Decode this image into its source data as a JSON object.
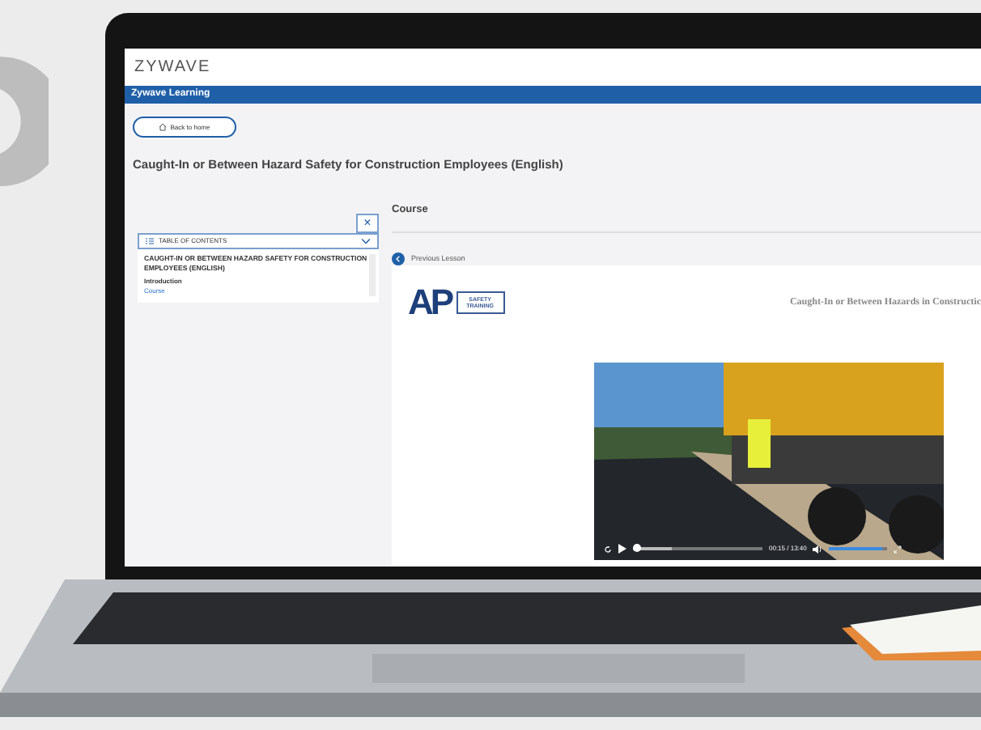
{
  "header": {
    "logo": "ZYWAVE"
  },
  "nav_bar": {
    "title": "Zywave Learning"
  },
  "back_button": {
    "label": "Back to home"
  },
  "page_title": "Caught-In or Between Hazard Safety for Construction Employees (English)",
  "sidebar": {
    "close_label": "×",
    "toc": {
      "title": "TABLE OF CONTENTS",
      "expanded": true,
      "course_title": "CAUGHT-IN OR BETWEEN HAZARD SAFETY FOR CONSTRUCTION EMPLOYEES (ENGLISH)",
      "items": [
        {
          "label": "Introduction",
          "selected": false
        },
        {
          "label": "Course",
          "selected": true
        }
      ]
    }
  },
  "content": {
    "heading": "Course",
    "previous_lesson": "Previous Lesson",
    "logo": {
      "letters": "AP",
      "badge": "SAFETY TRAINING"
    },
    "lesson_title": "Caught-In or Between Hazards in Constructic",
    "video": {
      "progress": {
        "level": 0.03,
        "buffered": {
          "level": 0.3
        }
      },
      "time": "00:15 / 13:40",
      "volume": {
        "level": 0.9
      }
    }
  }
}
